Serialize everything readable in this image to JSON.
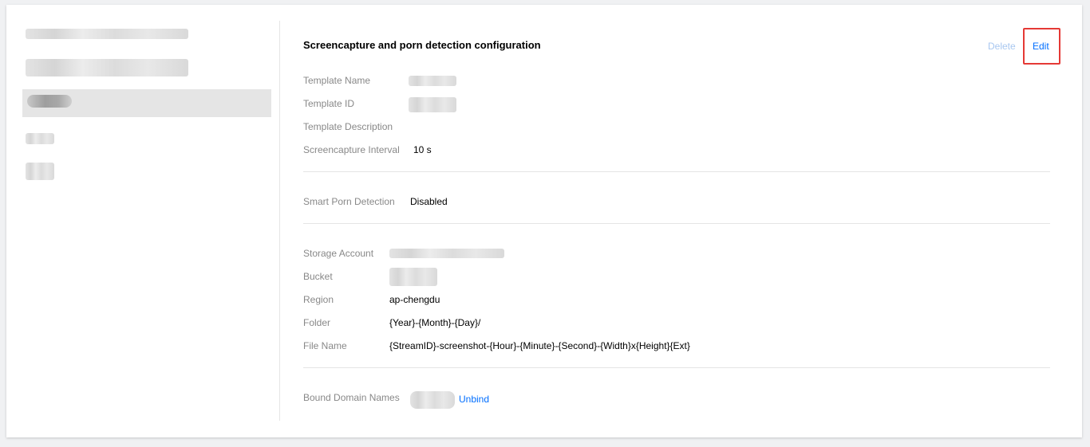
{
  "detail": {
    "title": "Screencapture and porn detection configuration",
    "actions": {
      "delete": "Delete",
      "edit": "Edit"
    },
    "basic": {
      "template_name_label": "Template Name",
      "template_id_label": "Template ID",
      "template_description_label": "Template Description",
      "screencapture_interval_label": "Screencapture Interval",
      "screencapture_interval_value": "10 s"
    },
    "porn": {
      "label": "Smart Porn Detection",
      "value": "Disabled"
    },
    "storage": {
      "account_label": "Storage Account",
      "bucket_label": "Bucket",
      "region_label": "Region",
      "region_value": "ap-chengdu",
      "folder_label": "Folder",
      "folder_value": "{Year}-{Month}-{Day}/",
      "file_name_label": "File Name",
      "file_name_value": "{StreamID}-screenshot-{Hour}-{Minute}-{Second}-{Width}x{Height}{Ext}"
    },
    "bound": {
      "label": "Bound Domain Names",
      "unbind": "Unbind"
    }
  },
  "colors": {
    "link": "#006eff",
    "link_disabled": "#a8c7f0",
    "highlight": "#e53935",
    "active_item": "#e5e5e5"
  }
}
